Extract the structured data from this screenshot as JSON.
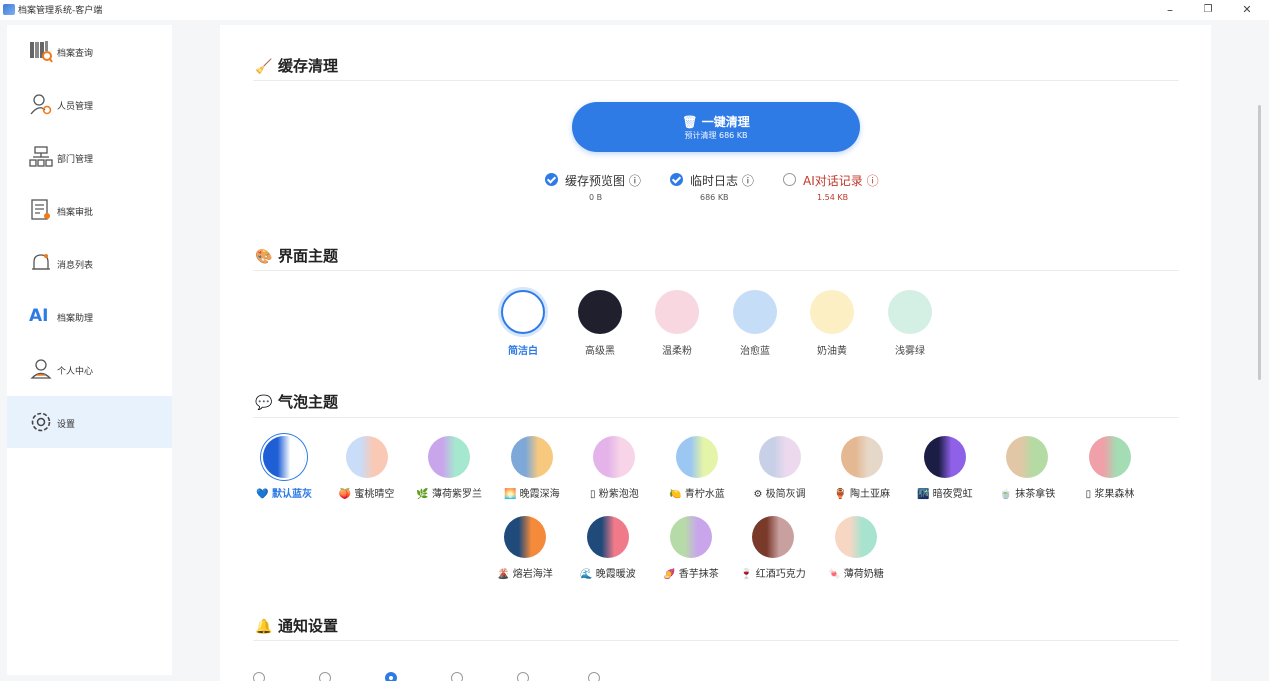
{
  "window": {
    "title": "档案管理系统-客户端",
    "min": "–",
    "max": "❐",
    "close": "✕"
  },
  "sidebar": {
    "items": [
      {
        "label": "档案查询",
        "icon": "archive-search-icon"
      },
      {
        "label": "人员管理",
        "icon": "user-gear-icon"
      },
      {
        "label": "部门管理",
        "icon": "org-chart-icon"
      },
      {
        "label": "档案审批",
        "icon": "document-approve-icon"
      },
      {
        "label": "消息列表",
        "icon": "bell-icon"
      },
      {
        "label": "档案助理",
        "icon": "ai-icon"
      },
      {
        "label": "个人中心",
        "icon": "person-icon"
      },
      {
        "label": "设置",
        "icon": "gear-icon"
      }
    ],
    "active_index": 7,
    "ai_glyph": "AI"
  },
  "cache": {
    "title": "缓存清理",
    "icon": "broom-icon",
    "button_label": "一键清理",
    "button_sub": "预计清理 686 KB",
    "options": [
      {
        "label": "缓存预览图 ⓘ",
        "size": "0 B",
        "checked": true,
        "color": "#333333",
        "size_color": "#555555"
      },
      {
        "label": "临时日志 ⓘ",
        "size": "686 KB",
        "checked": true,
        "color": "#333333",
        "size_color": "#555555"
      },
      {
        "label": "AI对话记录 ⓘ",
        "size": "1.54 KB",
        "checked": false,
        "color": "#c0392b",
        "size_color": "#c0392b"
      }
    ]
  },
  "ui_theme": {
    "title": "界面主题",
    "icon": "palette-icon",
    "themes": [
      {
        "label": "简洁白",
        "color": "#ffffff",
        "selected": true
      },
      {
        "label": "高级黑",
        "color": "#1f1f2e",
        "selected": false
      },
      {
        "label": "温柔粉",
        "color": "#f8d7e0",
        "selected": false
      },
      {
        "label": "治愈蓝",
        "color": "#c5ddf7",
        "selected": false
      },
      {
        "label": "奶油黄",
        "color": "#fdefc4",
        "selected": false
      },
      {
        "label": "浅雾绿",
        "color": "#d4efe3",
        "selected": false
      }
    ]
  },
  "bubble_theme": {
    "title": "气泡主题",
    "icon": "chat-bubble-icon",
    "items": [
      {
        "label": "💙 默认蓝灰",
        "c1": "#1f5fd6",
        "c2": "#ffffff",
        "selected": true
      },
      {
        "label": "🍑 蜜桃晴空",
        "c1": "#c9dcf8",
        "c2": "#f9c9b6",
        "selected": false
      },
      {
        "label": "🌿 薄荷紫罗兰",
        "c1": "#c9a6ec",
        "c2": "#a6e8cf",
        "selected": false
      },
      {
        "label": "🌅 晚霞深海",
        "c1": "#7ea8d8",
        "c2": "#f7c97e",
        "selected": false
      },
      {
        "label": "▯ 粉紫泡泡",
        "c1": "#e3b3ea",
        "c2": "#f7d4e8",
        "selected": false
      },
      {
        "label": "🍋 青柠水蓝",
        "c1": "#9cc7f2",
        "c2": "#e4f4a8",
        "selected": false
      },
      {
        "label": "⚙ 极简灰调",
        "c1": "#c7d0e6",
        "c2": "#ecd9ee",
        "selected": false
      },
      {
        "label": "🏺 陶土亚麻",
        "c1": "#e4b893",
        "c2": "#e6d8c8",
        "selected": false
      },
      {
        "label": "🌃 暗夜霓虹",
        "c1": "#1b1d45",
        "c2": "#8f60e8",
        "selected": false
      },
      {
        "label": "🍵 抹茶拿铁",
        "c1": "#e2c7a6",
        "c2": "#b4dba4",
        "selected": false
      },
      {
        "label": "▯ 浆果森林",
        "c1": "#f0a0a8",
        "c2": "#a4dcb4",
        "selected": false
      },
      {
        "label": "🌋 熔岩海洋",
        "c1": "#1f4a7a",
        "c2": "#f58a3a",
        "selected": false
      },
      {
        "label": "🌊 晚霞暖波",
        "c1": "#1f4a7a",
        "c2": "#f07a8a",
        "selected": false
      },
      {
        "label": "🍠 香芋抹茶",
        "c1": "#b7dba8",
        "c2": "#c9a6ec",
        "selected": false
      },
      {
        "label": "🍷 红酒巧克力",
        "c1": "#7a3a2a",
        "c2": "#c9a0a0",
        "selected": false
      },
      {
        "label": "🍬 薄荷奶糖",
        "c1": "#f7d7c4",
        "c2": "#a8e3d0",
        "selected": false
      }
    ]
  },
  "notify": {
    "title": "通知设置",
    "icon": "bell-icon"
  }
}
